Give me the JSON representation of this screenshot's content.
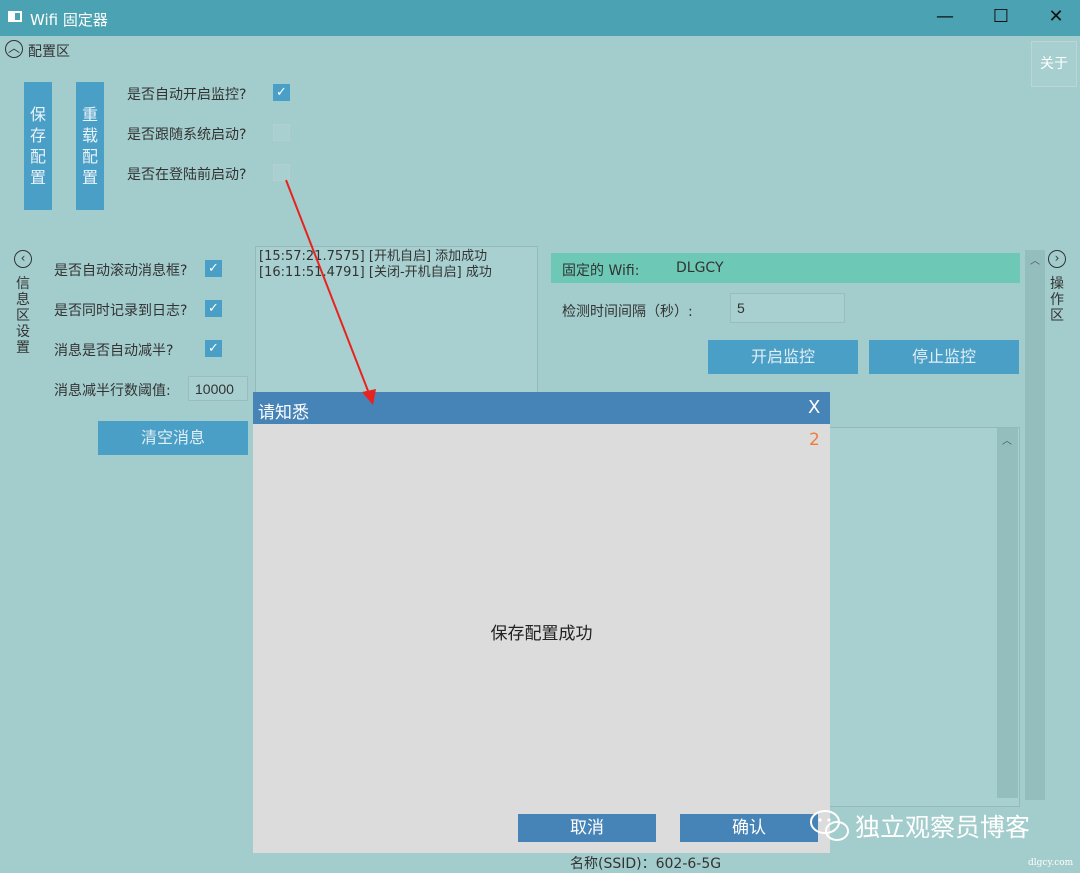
{
  "window": {
    "title": "Wifi 固定器",
    "minimize": "—",
    "maximize": "☐",
    "close": "✕"
  },
  "config": {
    "header": "配置区",
    "save_btn": "保存配置",
    "reload_btn": "重载配置",
    "options": [
      {
        "label": "是否自动开启监控?",
        "checked": true
      },
      {
        "label": "是否跟随系统启动?",
        "checked": false
      },
      {
        "label": "是否在登陆前启动?",
        "checked": false
      }
    ],
    "about": "关于"
  },
  "info": {
    "side_label": "信息区设置",
    "options": [
      {
        "label": "是否自动滚动消息框?",
        "checked": true
      },
      {
        "label": "是否同时记录到日志?",
        "checked": true
      },
      {
        "label": "消息是否自动减半?",
        "checked": true
      }
    ],
    "threshold_label": "消息减半行数阈值:",
    "threshold_value": "10000",
    "clear_btn": "清空消息",
    "log": [
      "[15:57:21.7575] [开机自启] 添加成功",
      "[16:11:51.4791] [关闭-开机自启] 成功"
    ]
  },
  "ops": {
    "side_label": "操作区",
    "fixed_wifi_label": "固定的 Wifi:",
    "fixed_wifi_value": "DLGCY",
    "interval_label": "检测时间间隔（秒）:",
    "interval_value": "5",
    "start_btn": "开启监控",
    "stop_btn": "停止监控",
    "ssid_text": "名称(SSID)：602-6-5G"
  },
  "dialog": {
    "title": "请知悉",
    "close": "X",
    "countdown": "2",
    "message": "保存配置成功",
    "cancel": "取消",
    "confirm": "确认"
  },
  "watermark": {
    "text": "独立观察员博客",
    "small": "dlgcy.com"
  },
  "colors": {
    "window_bg": "#a3cccc",
    "titlebar": "#4aa2b2",
    "accent_button": "#4a9fc7",
    "dialog_header": "#4683b7",
    "wifi_bar": "#6dc9b5",
    "annotation_arrow": "#e8231f"
  }
}
